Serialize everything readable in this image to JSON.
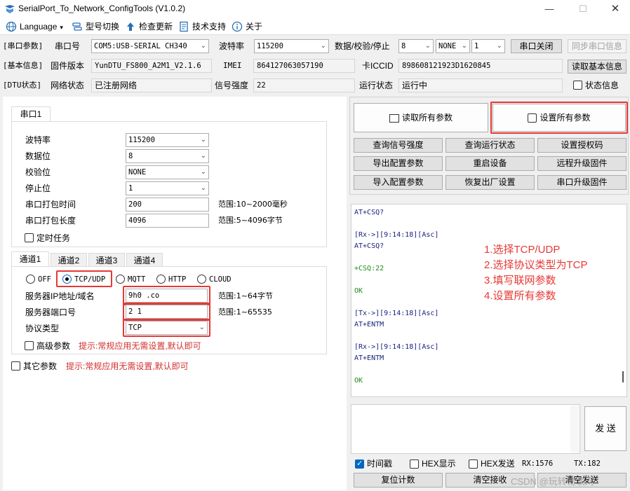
{
  "window": {
    "title": "SerialPort_To_Network_ConfigTools (V1.0.2)"
  },
  "menu": [
    {
      "label": "Language",
      "icon": "globe-icon"
    },
    {
      "label": "型号切换",
      "icon": "switch-icon"
    },
    {
      "label": "检查更新",
      "icon": "upload-arrow-icon"
    },
    {
      "label": "技术支持",
      "icon": "document-icon"
    },
    {
      "label": "关于",
      "icon": "info-icon"
    }
  ],
  "serial_params": {
    "section_label": "[串口参数]",
    "port_label": "串口号",
    "port_value": "COM5:USB-SERIAL CH340",
    "baud_label": "波特率",
    "baud_value": "115200",
    "format_label": "数据/校验/停止",
    "databits_value": "8",
    "parity_value": "NONE",
    "stopbits_value": "1",
    "close_button": "串口关闭",
    "sync_button": "同步串口信息"
  },
  "basic_info": {
    "section_label": "[基本信息]",
    "firmware_label": "固件版本",
    "firmware_value": "YunDTU_FS800_A2M1_V2.1.6",
    "imei_label": "IMEI",
    "imei_value": "864127063057190",
    "iccid_label": "卡ICCID",
    "iccid_value": "898608121923D1620845",
    "read_button": "读取基本信息"
  },
  "dtu_status": {
    "section_label": "[DTU状态]",
    "net_label": "网络状态",
    "net_value": "已注册网络",
    "signal_label": "信号强度",
    "signal_value": "22",
    "run_label": "运行状态",
    "run_value": "运行中",
    "status_info_label": "状态信息"
  },
  "serial_tab": {
    "tab_label": "串口1",
    "baud_label": "波特率",
    "baud_value": "115200",
    "databits_label": "数据位",
    "databits_value": "8",
    "parity_label": "校验位",
    "parity_value": "NONE",
    "stopbits_label": "停止位",
    "stopbits_value": "1",
    "pack_time_label": "串口打包时间",
    "pack_time_value": "200",
    "pack_time_range": "范围:10~2000毫秒",
    "pack_len_label": "串口打包长度",
    "pack_len_value": "4096",
    "pack_len_range": "范围:5~4096字节",
    "timer_task_label": "定时任务"
  },
  "channel_tabs": [
    "通道1",
    "通道2",
    "通道3",
    "通道4"
  ],
  "channel": {
    "modes": [
      "OFF",
      "TCP/UDP",
      "MQTT",
      "HTTP",
      "CLOUD"
    ],
    "selected_mode": "TCP/UDP",
    "server_label": "服务器IP地址/域名",
    "server_value": "9h0              .co",
    "server_range": "范围:1~64字节",
    "port_label": "服务器端口号",
    "port_value": "2   1",
    "port_range": "范围:1~65535",
    "protocol_label": "协议类型",
    "protocol_value": "TCP",
    "advanced_label": "高级参数",
    "advanced_hint": "提示:常规应用无需设置,默认即可"
  },
  "other_params": {
    "label": "其它参数",
    "hint": "提示:常规应用无需设置,默认即可"
  },
  "right_buttons": {
    "read_all": "读取所有参数",
    "set_all": "设置所有参数",
    "grid": [
      "查询信号强度",
      "查询运行状态",
      "设置授权码",
      "导出配置参数",
      "重启设备",
      "远程升级固件",
      "导入配置参数",
      "恢复出厂设置",
      "串口升级固件"
    ]
  },
  "log": [
    {
      "text": "AT+CSQ?",
      "cls": "tx"
    },
    {
      "text": "",
      "cls": ""
    },
    {
      "text": "[Rx->][9:14:18][Asc]",
      "cls": "rx"
    },
    {
      "text": "AT+CSQ?",
      "cls": "tx"
    },
    {
      "text": "",
      "cls": ""
    },
    {
      "text": "+CSQ:22",
      "cls": "green"
    },
    {
      "text": "",
      "cls": ""
    },
    {
      "text": "OK",
      "cls": "green"
    },
    {
      "text": "",
      "cls": ""
    },
    {
      "text": "[Tx->][9:14:18][Asc]",
      "cls": "tx"
    },
    {
      "text": "AT+ENTM",
      "cls": "tx"
    },
    {
      "text": "",
      "cls": ""
    },
    {
      "text": "[Rx->][9:14:18][Asc]",
      "cls": "rx"
    },
    {
      "text": "AT+ENTM",
      "cls": "tx"
    },
    {
      "text": "",
      "cls": ""
    },
    {
      "text": "OK",
      "cls": "green"
    }
  ],
  "annotations": [
    "1.选择TCP/UDP",
    "2.选择协议类型为TCP",
    "3.填写联网参数",
    "4.设置所有参数"
  ],
  "send_area": {
    "send_button": "发 送",
    "timestamp_label": "时间戳",
    "hex_display_label": "HEX显示",
    "hex_send_label": "HEX发送",
    "rx_count": "RX:1576",
    "tx_count": "TX:182",
    "reset_count_button": "复位计数",
    "clear_rx_button": "清空接收",
    "clear_tx_button": "清空发送"
  },
  "watermark": "CSDN @玩转物联网",
  "colors": {
    "highlight": "#e53935",
    "accent": "#0067c0",
    "annotation": "#e53935"
  }
}
